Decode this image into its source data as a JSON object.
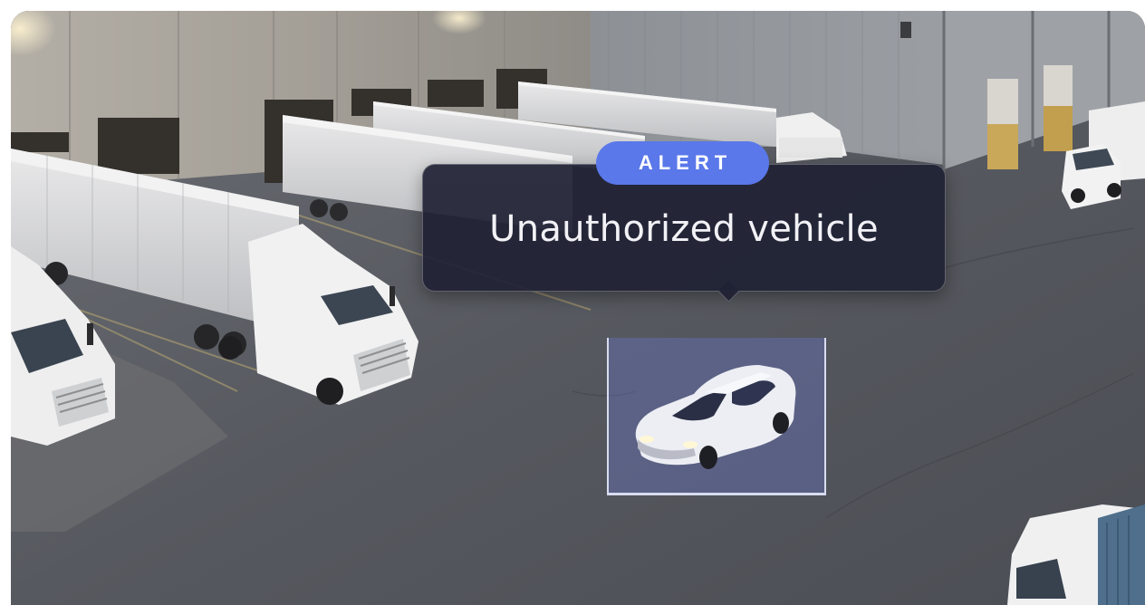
{
  "alert": {
    "badge_label": "ALERT",
    "message": "Unauthorized vehicle"
  },
  "detection": {
    "object": "car-icon"
  },
  "colors": {
    "badge": "#5a78ea",
    "card_background": "#202234",
    "detection_overlay": "#6e78d2",
    "frame_outline": "#d8dcf0"
  }
}
